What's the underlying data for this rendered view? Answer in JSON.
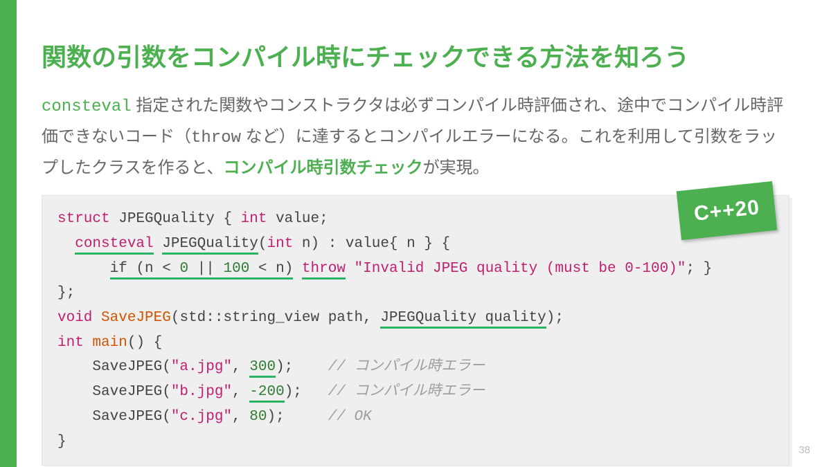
{
  "title": "関数の引数をコンパイル時にチェックできる方法を知ろう",
  "body": {
    "pre": "",
    "consteval": "consteval",
    "mid1": " 指定された関数やコンストラクタは必ずコンパイル時評価され、途中でコンパイル時評価できないコード（",
    "throw": "throw",
    "mid2": " など）に達するとコンパイルエラーになる。これを利用して引数をラップしたクラスを作ると、",
    "highlight": "コンパイル時引数チェック",
    "tail": "が実現。"
  },
  "badge": "C++20",
  "code": {
    "l1_struct": "struct",
    "l1_name": " JPEGQuality { ",
    "l1_int": "int",
    "l1_value": " value;",
    "l2_indent": "  ",
    "l2_consteval": "consteval",
    "l2_sp": " ",
    "l2_ctor": "JPEGQuality",
    "l2_open": "(",
    "l2_int": "int",
    "l2_rest": " n) : value{ n } {",
    "l3_indent": "      ",
    "l3_if": "if (n < ",
    "l3_zero": "0",
    "l3_or": " || ",
    "l3_hundred": "100",
    "l3_lt": " < n)",
    "l3_sp": " ",
    "l3_throw": "throw",
    "l3_sp2": " ",
    "l3_str": "\"Invalid JPEG quality (must be 0-100)\"",
    "l3_end": "; }",
    "l4": "};",
    "l5_void": "void",
    "l5_sp": " ",
    "l5_fn": "SaveJPEG",
    "l5_args1": "(std::string_view path, ",
    "l5_args2": "JPEGQuality quality",
    "l5_args3": ");",
    "l6_int": "int",
    "l6_sp": " ",
    "l6_main": "main",
    "l6_rest": "() {",
    "l7_indent": "    SaveJPEG(",
    "l7_str": "\"a.jpg\"",
    "l7_comma": ", ",
    "l7_num": "300",
    "l7_close": ");    ",
    "l7_cmt": "// コンパイル時エラー",
    "l8_indent": "    SaveJPEG(",
    "l8_str": "\"b.jpg\"",
    "l8_comma": ", ",
    "l8_num": "-200",
    "l8_close": ");   ",
    "l8_cmt": "// コンパイル時エラー",
    "l9_indent": "    SaveJPEG(",
    "l9_str": "\"c.jpg\"",
    "l9_comma": ", ",
    "l9_num": "80",
    "l9_close": ");     ",
    "l9_cmt": "// OK",
    "l10": "}"
  },
  "page_num": "38"
}
